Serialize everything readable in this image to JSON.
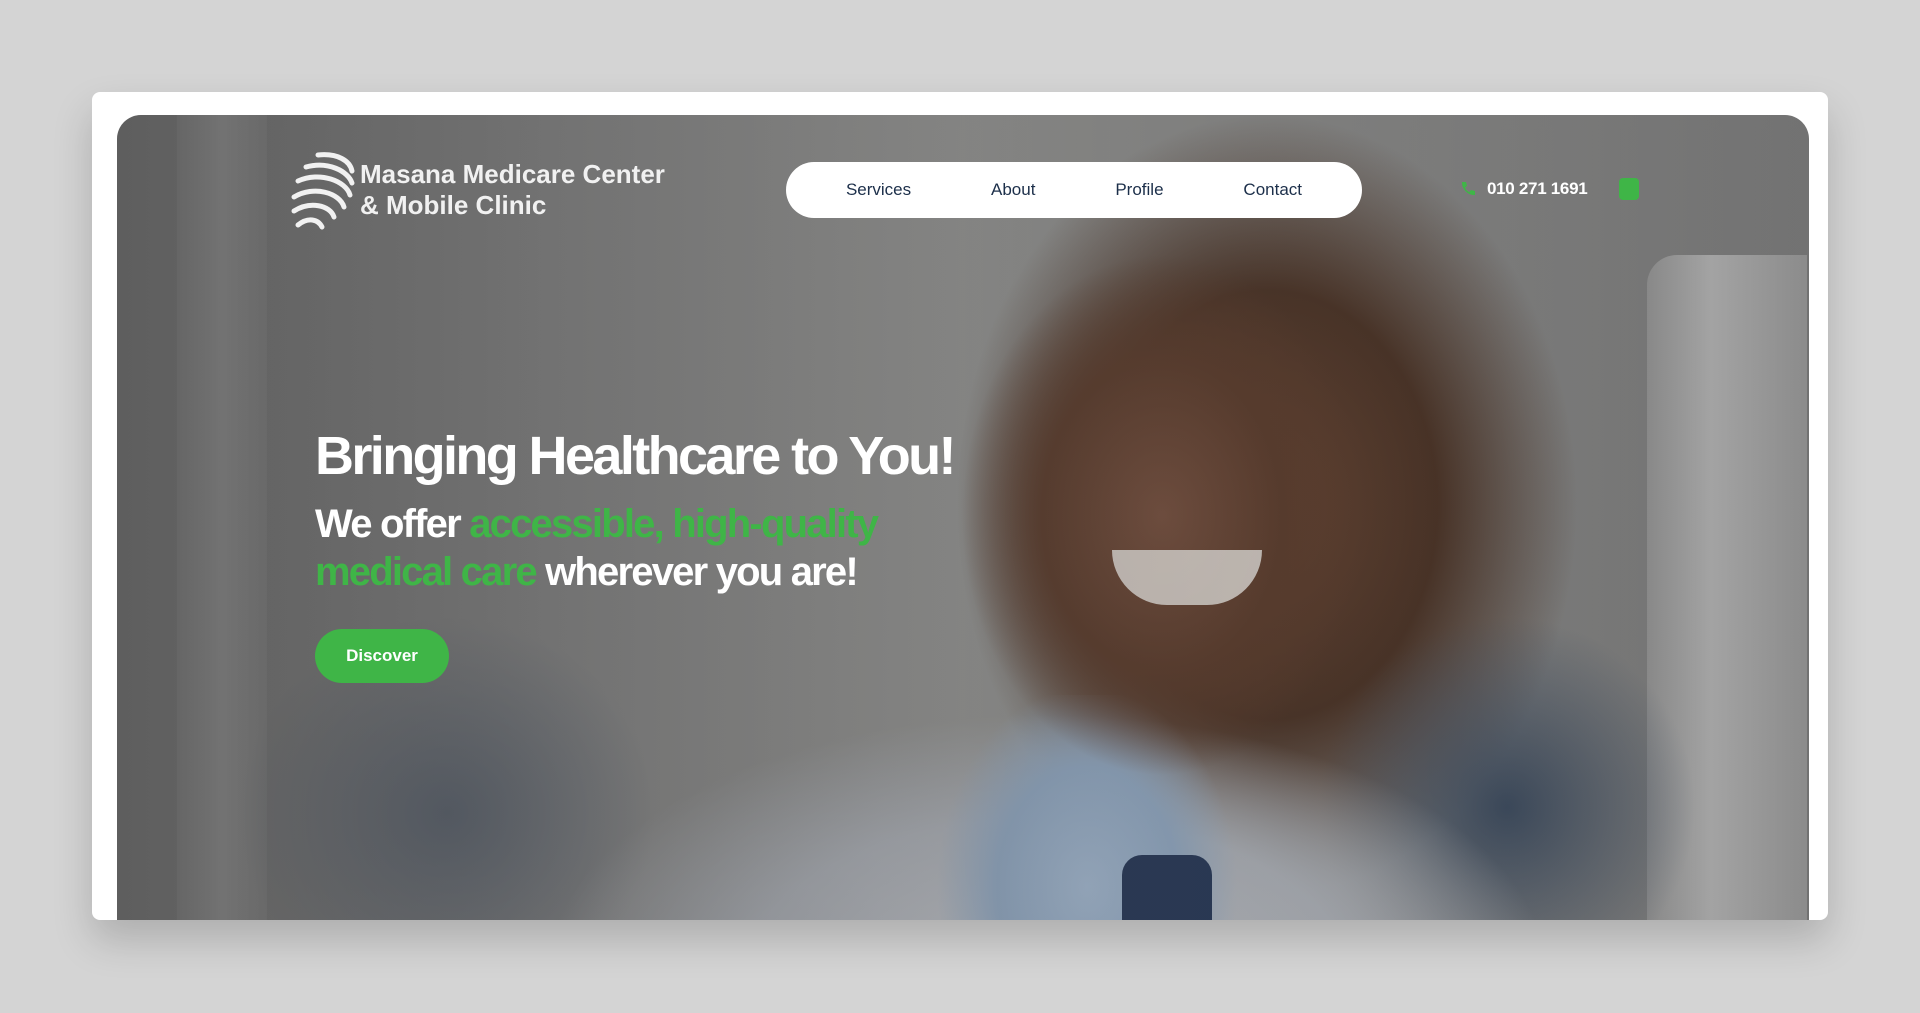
{
  "brand": {
    "line1": "Masana Medicare Center",
    "line2": "& Mobile Clinic",
    "logo_icon": "striped-globe-logo-icon"
  },
  "nav": {
    "items": [
      {
        "label": "Services"
      },
      {
        "label": "About"
      },
      {
        "label": "Profile"
      },
      {
        "label": "Contact"
      }
    ]
  },
  "contact": {
    "phone": "010 271 1691",
    "phone_icon": "phone-icon",
    "social_icon": "social-icon"
  },
  "hero": {
    "headline": "Bringing Healthcare to You!",
    "sub_part1": "We offer ",
    "sub_highlight1": "accessible, high-quality",
    "sub_highlight2": "medical care",
    "sub_part2": " wherever you are!",
    "cta_label": "Discover",
    "image_description_icon": "doctor-photo"
  },
  "colors": {
    "accent": "#3fb547",
    "nav_text": "#1c2f4a",
    "page_bg": "#d4d4d4",
    "card_bg": "#ffffff"
  }
}
